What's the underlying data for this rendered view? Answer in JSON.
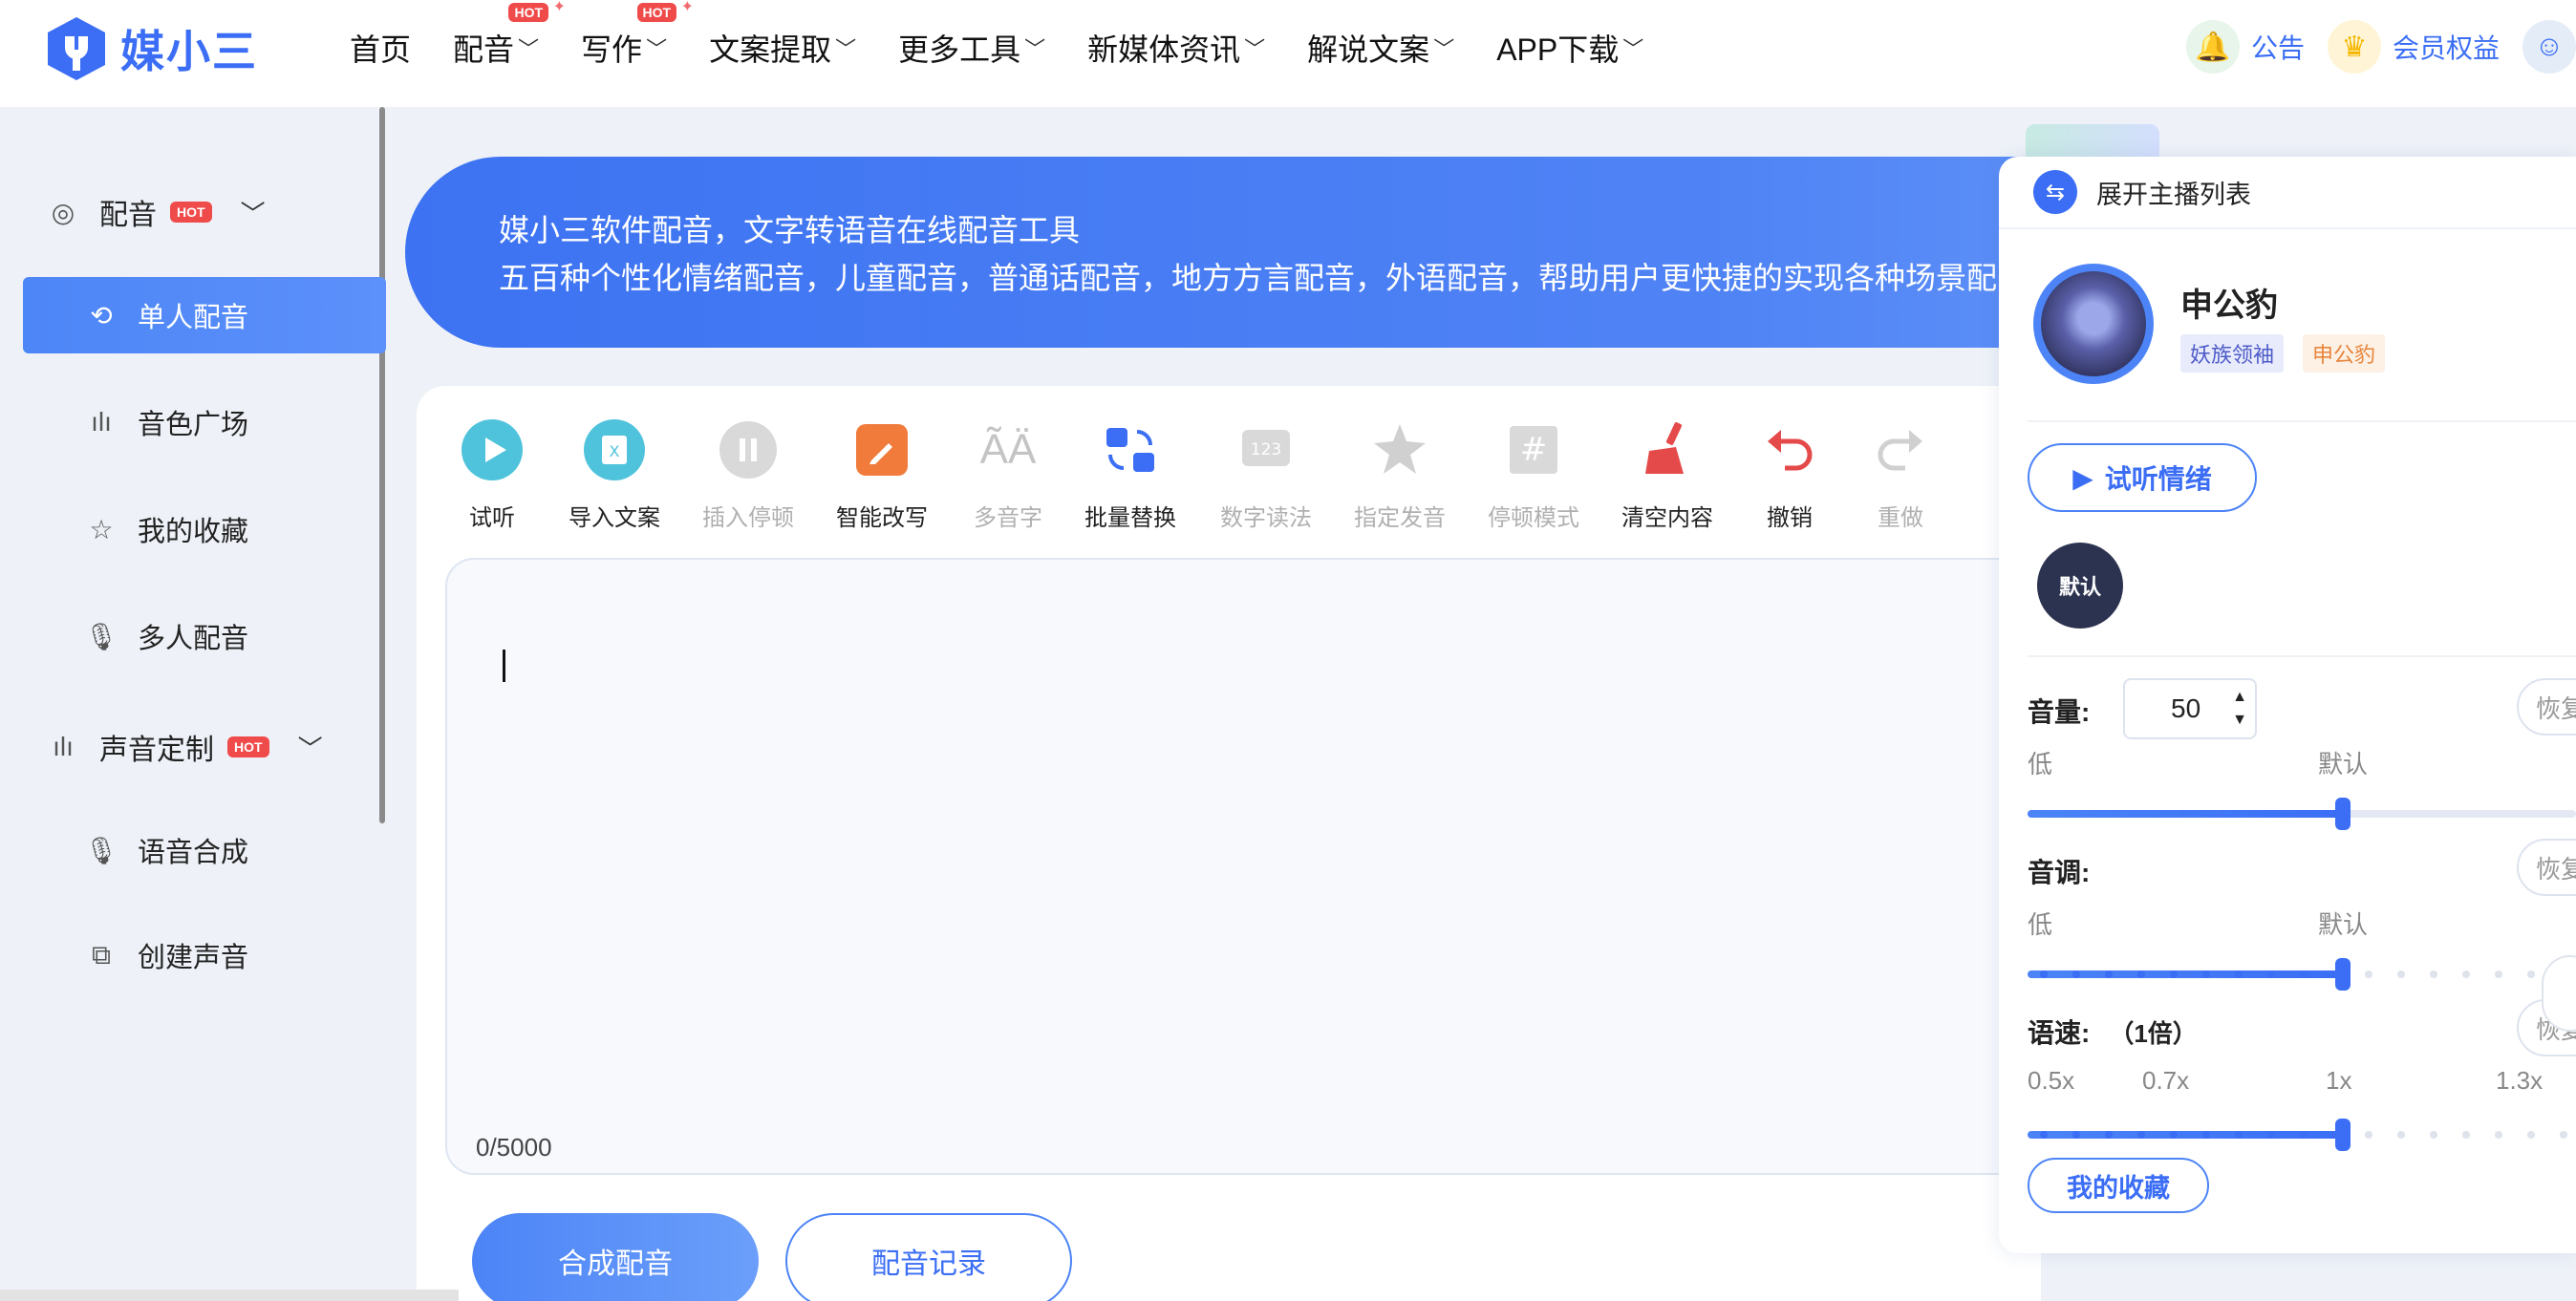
{
  "brand": {
    "name": "媒小三",
    "color": "#3b6ef5"
  },
  "nav": {
    "items": [
      {
        "label": "首页",
        "has_dropdown": false,
        "hot": false
      },
      {
        "label": "配音",
        "has_dropdown": true,
        "hot": true
      },
      {
        "label": "写作",
        "has_dropdown": true,
        "hot": true
      },
      {
        "label": "文案提取",
        "has_dropdown": true,
        "hot": false
      },
      {
        "label": "更多工具",
        "has_dropdown": true,
        "hot": false
      },
      {
        "label": "新媒体资讯",
        "has_dropdown": true,
        "hot": false
      },
      {
        "label": "解说文案",
        "has_dropdown": true,
        "hot": false
      },
      {
        "label": "APP下载",
        "has_dropdown": true,
        "hot": false
      }
    ],
    "hot_badge": "HOT",
    "notice_label": "公告",
    "vip_label": "会员权益"
  },
  "sidebar": {
    "group_dubbing": {
      "label": "配音",
      "hot": "HOT"
    },
    "items_dubbing": [
      {
        "label": "单人配音",
        "icon": "repeat-icon",
        "active": true
      },
      {
        "label": "音色广场",
        "icon": "waveform-icon",
        "active": false
      },
      {
        "label": "我的收藏",
        "icon": "star-icon",
        "active": false
      },
      {
        "label": "多人配音",
        "icon": "mic-icon",
        "active": false
      }
    ],
    "group_custom": {
      "label": "声音定制",
      "hot": "HOT"
    },
    "items_custom": [
      {
        "label": "语音合成",
        "icon": "mic-icon"
      },
      {
        "label": "创建声音",
        "icon": "copy-icon"
      }
    ]
  },
  "banner": {
    "line1": "媒小三软件配音，文字转语音在线配音工具",
    "line2": "五百种个性化情绪配音，儿童配音，普通话配音，地方方言配音，外语配音，帮助用户更快捷的实现各种场景配"
  },
  "toolbar": [
    {
      "label": "试听",
      "icon": "play-icon",
      "enabled": true
    },
    {
      "label": "导入文案",
      "icon": "import-excel-icon",
      "enabled": true
    },
    {
      "label": "插入停顿",
      "icon": "pause-icon",
      "enabled": false
    },
    {
      "label": "智能改写",
      "icon": "edit-icon",
      "enabled": true
    },
    {
      "label": "多音字",
      "icon": "polyphone-icon",
      "enabled": false
    },
    {
      "label": "批量替换",
      "icon": "replace-icon",
      "enabled": true
    },
    {
      "label": "数字读法",
      "icon": "number-icon",
      "enabled": false
    },
    {
      "label": "指定发音",
      "icon": "pronounce-icon",
      "enabled": false
    },
    {
      "label": "停顿模式",
      "icon": "hash-icon",
      "enabled": false
    },
    {
      "label": "清空内容",
      "icon": "broom-icon",
      "enabled": true
    },
    {
      "label": "撤销",
      "icon": "undo-icon",
      "enabled": true
    },
    {
      "label": "重做",
      "icon": "redo-icon",
      "enabled": false
    }
  ],
  "editor": {
    "counter": "0/5000"
  },
  "actions": {
    "synth": "合成配音",
    "record": "配音记录"
  },
  "panel": {
    "header": "展开主播列表",
    "speaker": {
      "name": "申公豹",
      "tag1": "妖族领袖",
      "tag2": "申公豹"
    },
    "emotion_button": "试听情绪",
    "emotion_default": "默认",
    "volume": {
      "label": "音量:",
      "value": "50",
      "low": "低",
      "default": "默认",
      "reset": "恢复",
      "level": 0.5
    },
    "pitch": {
      "label": "音调:",
      "low": "低",
      "default": "默认",
      "reset": "恢复",
      "level": 0.5
    },
    "speed": {
      "label": "语速:",
      "value": "（1倍）",
      "reset": "恢复",
      "marks": [
        "0.5x",
        "0.7x",
        "1x",
        "1.3x"
      ],
      "level": 0.5
    },
    "favorites": "我的收藏"
  }
}
